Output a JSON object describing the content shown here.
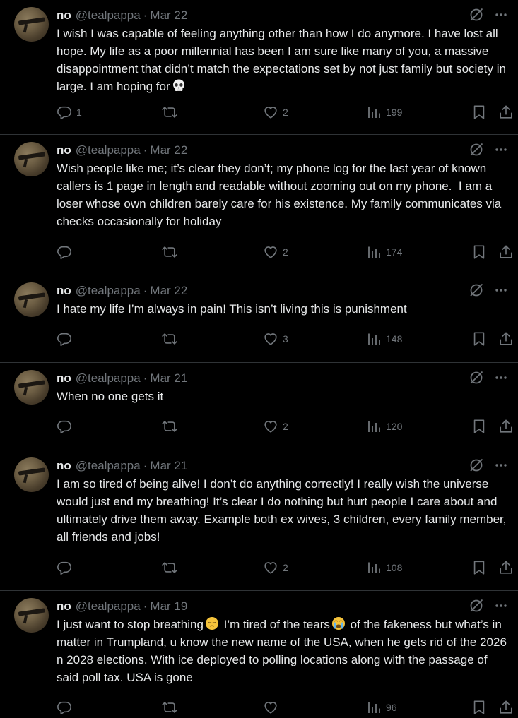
{
  "user": {
    "display_name": "no",
    "handle": "@tealpappa",
    "separator": "·"
  },
  "colors": {
    "background": "#000000",
    "text": "#e7e9ea",
    "muted": "#71767b",
    "divider": "#2f3336"
  },
  "icons": {
    "reply": "reply-icon",
    "retweet": "retweet-icon",
    "like": "heart-icon",
    "views": "views-icon",
    "bookmark": "bookmark-icon",
    "share": "share-icon",
    "grok": "grok-icon",
    "more": "more-icon"
  },
  "posts": [
    {
      "date": "Mar 22",
      "text": "I wish I was capable of feeling anything other than how I do anymore. I have lost all hope. My life as a poor millennial has been I am sure like many of you, a massive disappointment that didn’t match the expectations set by not just family but society in large. I am hoping for",
      "emoji": "skull",
      "replies": "1",
      "reposts": "",
      "likes": "2",
      "views": "199"
    },
    {
      "date": "Mar 22",
      "text": "Wish people like me; it’s clear they don’t; my phone log for the last year of known callers is 1 page in length and readable without zooming out on my phone.  I am a loser whose own children barely care for his existence. My family communicates via checks occasionally for holiday",
      "replies": "",
      "reposts": "",
      "likes": "2",
      "views": "174"
    },
    {
      "date": "Mar 22",
      "text": "I hate my life I’m always in pain! This isn’t living this is punishment",
      "replies": "",
      "reposts": "",
      "likes": "3",
      "views": "148"
    },
    {
      "date": "Mar 21",
      "text": "When no one gets it",
      "replies": "",
      "reposts": "",
      "likes": "2",
      "views": "120"
    },
    {
      "date": "Mar 21",
      "text": "I am so tired of being alive! I don’t do anything correctly! I really wish the universe would just end my breathing! It’s clear I do nothing but hurt people I care about and ultimately drive them away. Example both ex wives, 3 children, every family member, all friends and jobs!",
      "replies": "",
      "reposts": "",
      "likes": "2",
      "views": "108"
    },
    {
      "date": "Mar 19",
      "text_a": "I just want to stop breathing",
      "text_b": " I’m tired of the tears",
      "text_c": " of the fakeness but what’s in matter in Trumpland, u know the new name of the USA, when he gets rid of the 2026 n 2028 elections. With ice deployed to polling locations along with the passage of said poll tax. USA is gone",
      "emoji_a": "pensive-face",
      "emoji_b": "crying-face",
      "replies": "",
      "reposts": "",
      "likes": "",
      "views": "96"
    }
  ]
}
